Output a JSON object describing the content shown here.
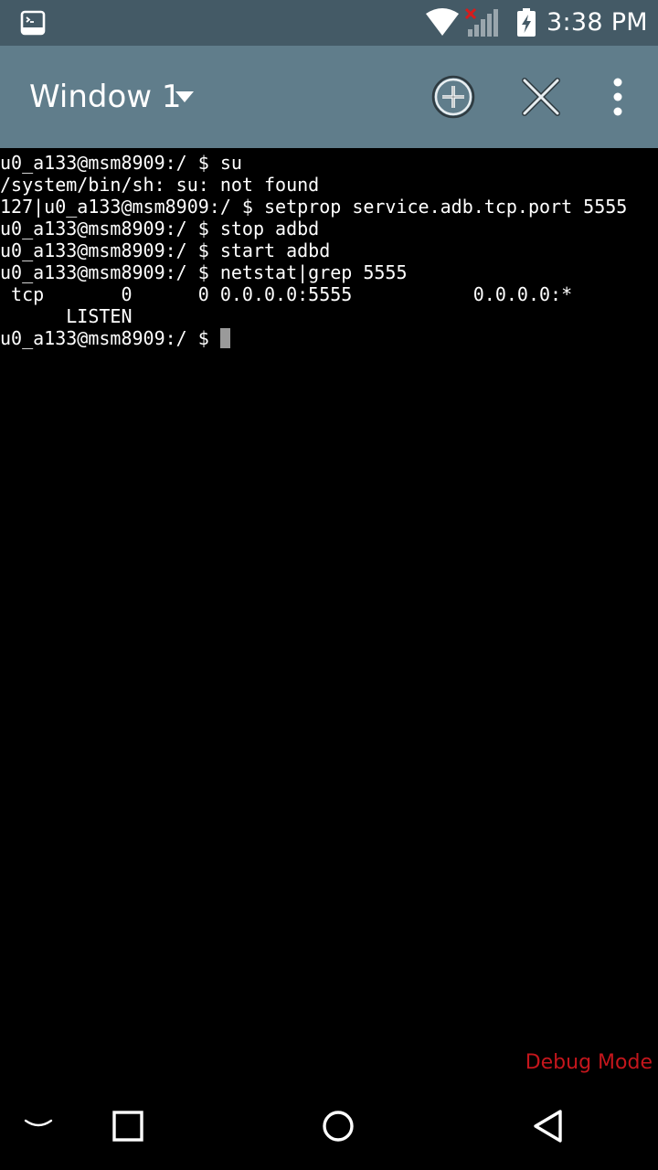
{
  "status_bar": {
    "time": "3:38 PM",
    "icons": [
      "terminal-notification-icon",
      "wifi-icon",
      "cell-signal-no-data-icon",
      "battery-charging-icon"
    ]
  },
  "app_bar": {
    "window_title": "Window 1",
    "actions": [
      "add-window-icon",
      "close-window-icon",
      "overflow-menu-icon"
    ]
  },
  "terminal": {
    "lines": [
      "u0_a133@msm8909:/ $ su",
      "/system/bin/sh: su: not found",
      "127|u0_a133@msm8909:/ $ setprop service.adb.tcp.port 5555",
      "u0_a133@msm8909:/ $ stop adbd",
      "u0_a133@msm8909:/ $ start adbd",
      "u0_a133@msm8909:/ $ netstat|grep 5555",
      " tcp       0      0 0.0.0.0:5555           0.0.0.0:*",
      "      LISTEN"
    ],
    "prompt": "u0_a133@msm8909:/ $ "
  },
  "debug_label": "Debug Mode",
  "colors": {
    "status_bar": "#445a66",
    "app_bar": "#607d8b",
    "debug_text": "#c4161c",
    "cursor": "#9a9a9a"
  },
  "nav_bar": {
    "buttons": [
      "hide-keyboard-icon",
      "recents-icon",
      "home-icon",
      "back-icon"
    ]
  }
}
